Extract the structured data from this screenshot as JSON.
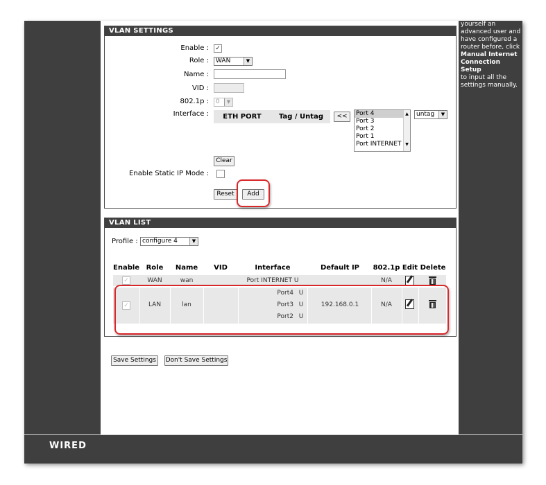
{
  "colors": {
    "dark": "#3f3f3f",
    "highlight": "#d8282b",
    "table_row": "#e8e8e8"
  },
  "help_text": {
    "line1": "yourself an",
    "line2": "advanced user and",
    "line3": "have configured a",
    "line4": "router before, click",
    "bold1": "Manual Internet",
    "bold2": "Connection Setup",
    "line5": "to input all the",
    "line6": "settings manually."
  },
  "vlan_settings": {
    "title": "VLAN SETTINGS",
    "enable_label": "Enable :",
    "enable_checked": "✓",
    "role_label": "Role :",
    "role_value": "WAN",
    "name_label": "Name :",
    "name_value": "",
    "vid_label": "VID :",
    "vid_value": "",
    "priority_label": "802.1p :",
    "priority_value": "0",
    "interface_label": "Interface :",
    "col_eth_port": "ETH PORT",
    "col_tag_untag": "Tag / Untag",
    "move_button": "<<",
    "ports": [
      "Port 4",
      "Port 3",
      "Port 2",
      "Port 1",
      "Port INTERNET"
    ],
    "tag_value": "untag",
    "clear_button": "Clear",
    "static_ip_label": "Enable Static IP Mode :",
    "reset_button": "Reset",
    "add_button": "Add"
  },
  "vlan_list": {
    "title": "VLAN LIST",
    "profile_label": "Profile :",
    "profile_value": "configure 4",
    "headers": {
      "enable": "Enable",
      "role": "Role",
      "name": "Name",
      "vid": "VID",
      "interface": "Interface",
      "default_ip": "Default IP",
      "priority": "802.1p",
      "edit": "Edit",
      "delete": "Delete"
    },
    "row1": {
      "enable": "✓",
      "role": "WAN",
      "name": "wan",
      "vid": "",
      "interface": "Port INTERNET U",
      "default_ip": "",
      "priority": "N/A"
    },
    "row2": {
      "enable": "✓",
      "role": "LAN",
      "name": "lan",
      "vid": "",
      "ports": [
        {
          "port": "Port4",
          "tag": "U"
        },
        {
          "port": "Port3",
          "tag": "U"
        },
        {
          "port": "Port2",
          "tag": "U"
        }
      ],
      "default_ip": "192.168.0.1",
      "priority": "N/A"
    }
  },
  "buttons": {
    "save": "Save Settings",
    "dont_save": "Don't Save Settings"
  },
  "footer": {
    "logo": "WIRED"
  }
}
